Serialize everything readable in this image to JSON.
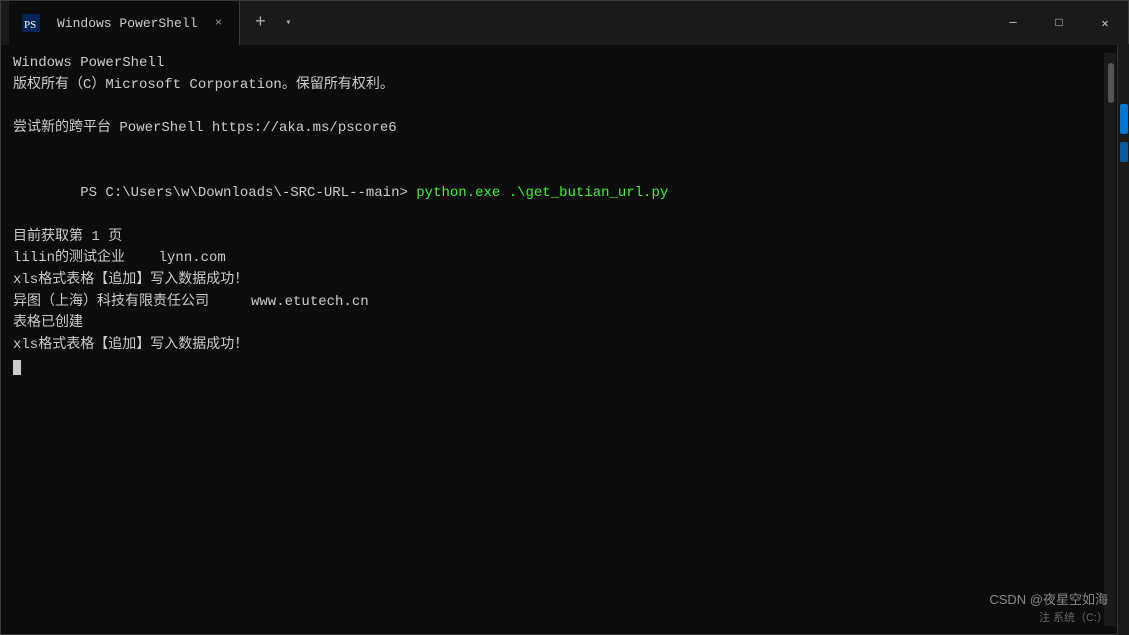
{
  "titlebar": {
    "title": "Windows PowerShell",
    "tab_close_label": "×",
    "new_tab_label": "+",
    "dropdown_label": "▾",
    "minimize_label": "─",
    "maximize_label": "□",
    "close_label": "✕"
  },
  "terminal": {
    "lines": [
      {
        "type": "normal",
        "text": "Windows PowerShell"
      },
      {
        "type": "normal",
        "text": "版权所有（C）Microsoft Corporation。保留所有权利。"
      },
      {
        "type": "empty",
        "text": ""
      },
      {
        "type": "normal",
        "text": "尝试新的跨平台 PowerShell https://aka.ms/pscore6"
      },
      {
        "type": "empty",
        "text": ""
      },
      {
        "type": "prompt",
        "path": "PS C:\\Users\\w\\Downloads\\-SRC-URL--main>",
        "cmd": " python.exe .\\get_butian_url.py"
      },
      {
        "type": "normal",
        "text": "目前获取第 1 页"
      },
      {
        "type": "normal",
        "text": "lilin的测试企业    lynn.com"
      },
      {
        "type": "normal",
        "text": "xls格式表格【追加】写入数据成功！"
      },
      {
        "type": "normal",
        "text": "异图（上海）科技有限责任公司     www.etutech.cn"
      },
      {
        "type": "normal",
        "text": "表格已创建"
      },
      {
        "type": "normal",
        "text": "xls格式表格【追加】写入数据成功！"
      },
      {
        "type": "cursor",
        "text": ""
      }
    ]
  },
  "watermark": {
    "name": "CSDN @夜星空如海",
    "system": "注 系统（C:）"
  }
}
